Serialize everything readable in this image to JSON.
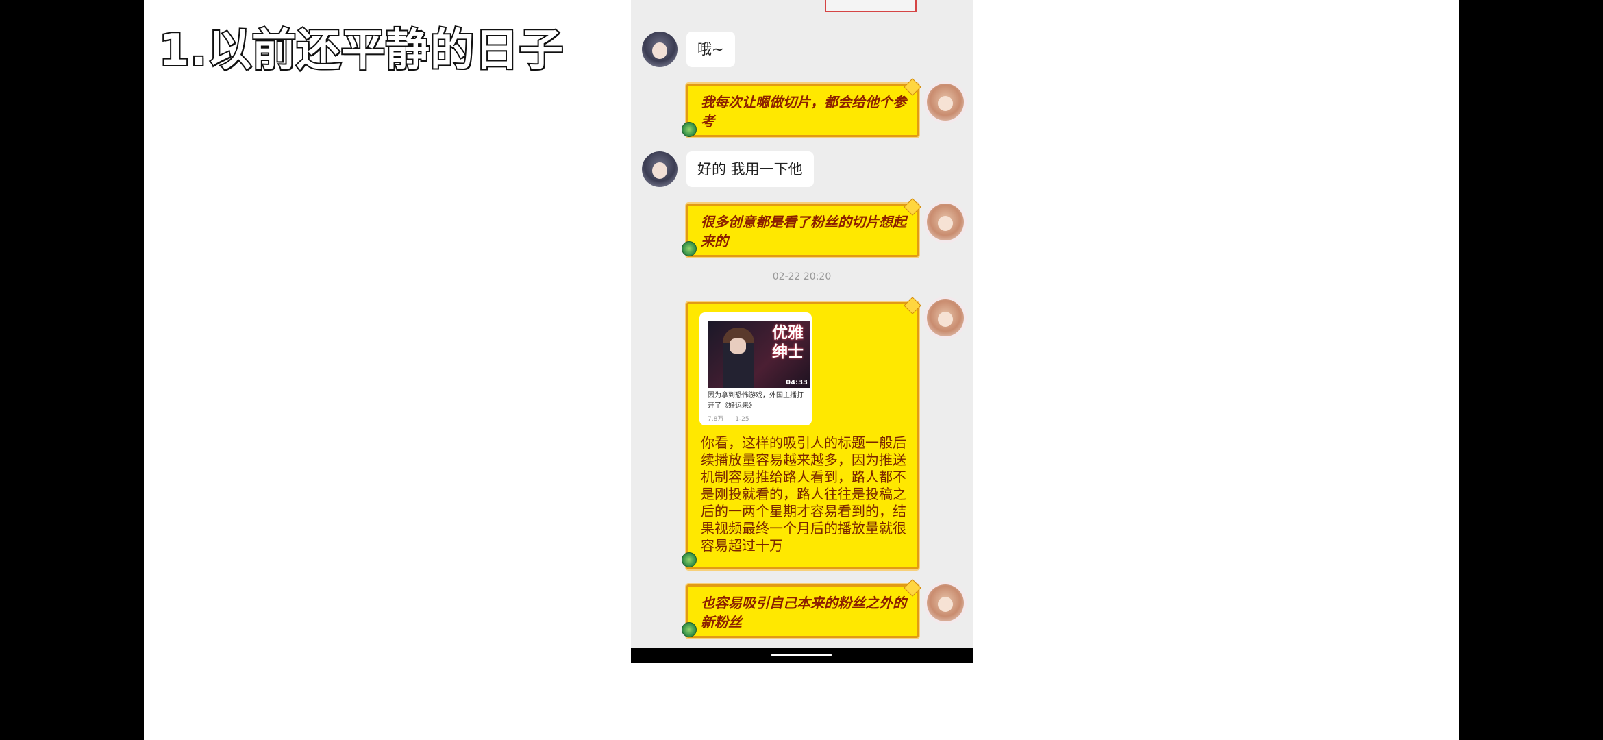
{
  "caption": "1.以前还平静的日子",
  "chat": {
    "messages": [
      {
        "side": "left",
        "text": "哦~"
      },
      {
        "side": "right",
        "text": "我每次让嗯做切片，都会给他个参考"
      },
      {
        "side": "left",
        "text": "好的 我用一下他"
      },
      {
        "side": "right",
        "text": "很多创意都是看了粉丝的切片想起来的"
      },
      {
        "side": "right",
        "text": "也容易吸引自己本来的粉丝之外的新粉丝"
      }
    ],
    "timestamp": "02-22 20:20",
    "card": {
      "thumb_title": "优雅绅士",
      "duration": "04:33",
      "title": "因为拿到恐怖游戏，外国主播打开了《好运来》",
      "views": "7.8万",
      "date": "1-25"
    },
    "long_message": "你看，这样的吸引人的标题一般后续播放量容易越来越多，因为推送机制容易推给路人看到，路人都不是刚投就看的，路人往往是投稿之后的一两个星期才容易看到的，结果视频最终一个月后的播放量就很容易超过十万"
  },
  "colors": {
    "bubble_yellow": "#ffe800",
    "bubble_border": "#e29b14",
    "chat_bg": "#ededed"
  }
}
